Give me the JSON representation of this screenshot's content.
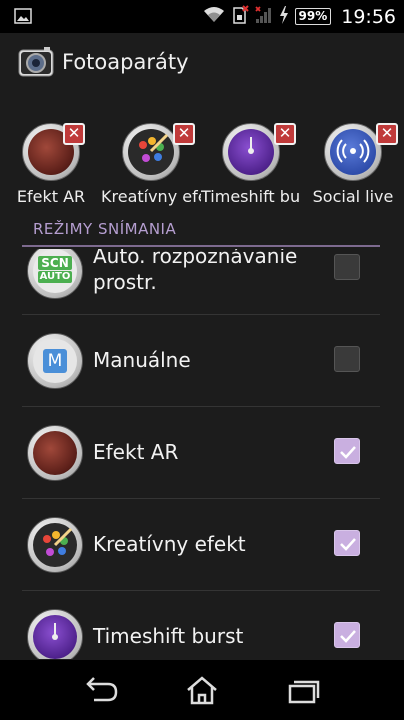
{
  "status_bar": {
    "battery_text": "99%",
    "time": "19:56",
    "icons": [
      "image-icon",
      "wifi-icon",
      "sim-icon",
      "signal-icon",
      "charging-icon"
    ]
  },
  "action_bar": {
    "title": "Fotoaparáty",
    "icon": "camera-icon"
  },
  "favorites": [
    {
      "label": "Efekt AR",
      "icon": "dinosaur-icon"
    },
    {
      "label": "Kreatívny efekt",
      "icon": "palette-icon"
    },
    {
      "label": "Timeshift burst",
      "icon": "timeshift-icon"
    },
    {
      "label": "Social live",
      "icon": "broadcast-icon"
    }
  ],
  "section": {
    "title": "REŽIMY SNÍMANIA"
  },
  "modes": [
    {
      "label_line1": "Auto. rozpoznávanie",
      "label_line2": "prostr.",
      "icon": "scn-auto-icon",
      "checked": false
    },
    {
      "label_line1": "Manuálne",
      "label_line2": "",
      "icon": "manual-icon",
      "checked": false
    },
    {
      "label_line1": "Efekt AR",
      "label_line2": "",
      "icon": "dinosaur-icon",
      "checked": true
    },
    {
      "label_line1": "Kreatívny efekt",
      "label_line2": "",
      "icon": "palette-icon",
      "checked": true
    },
    {
      "label_line1": "Timeshift burst",
      "label_line2": "",
      "icon": "timeshift-icon",
      "checked": true
    }
  ],
  "scn_icon_text": {
    "top": "SCN",
    "bottom": "AUTO"
  },
  "manual_icon_text": "M",
  "colors": {
    "accent": "#b59ed0",
    "checkbox_checked": "#c9afe0",
    "remove_badge": "#c03a3a"
  }
}
